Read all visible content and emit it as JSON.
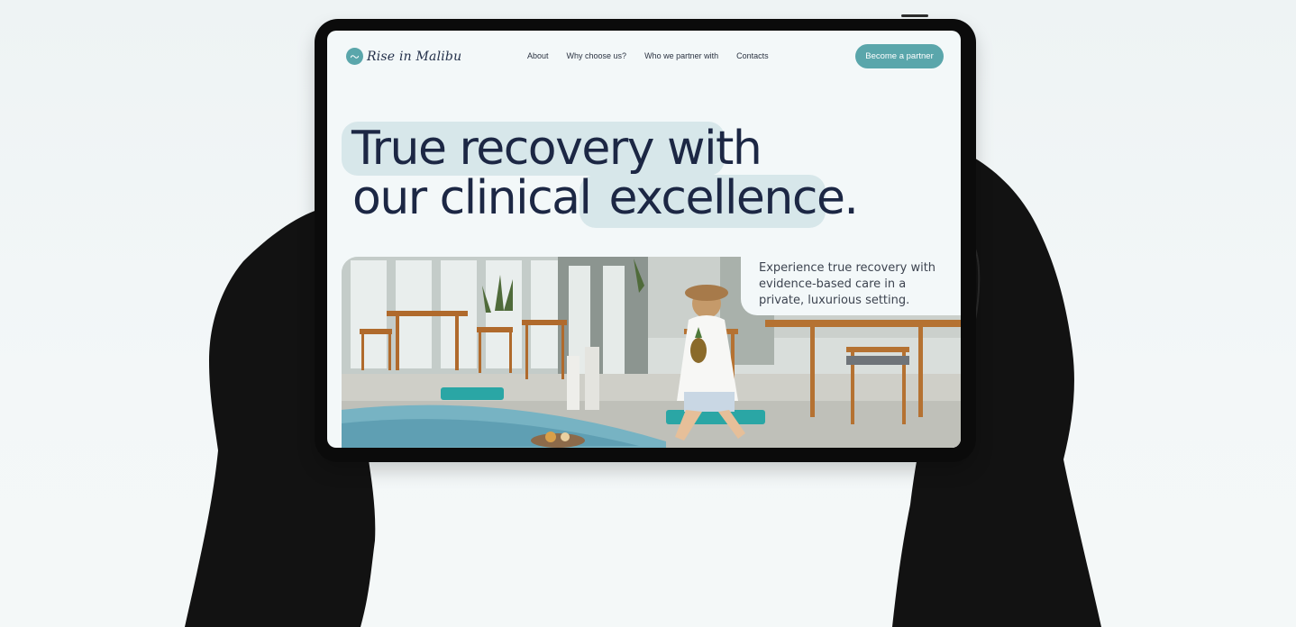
{
  "site": {
    "logo_text": "Rise in Malibu",
    "nav": [
      {
        "label": "About"
      },
      {
        "label": "Why choose us?"
      },
      {
        "label": "Who we partner with"
      },
      {
        "label": "Contacts"
      }
    ],
    "cta_label": "Become a partner"
  },
  "hero": {
    "headline_line1": "True recovery with",
    "headline_line2_part1": "our clinical",
    "headline_line2_part2": "excellence.",
    "caption": "Experience true recovery with evidence-based care in a private, luxurious setting."
  },
  "colors": {
    "accent": "#5aa6ab",
    "highlight": "#d7e7ea",
    "text_dark": "#1c2744",
    "background": "#f3f8f9"
  }
}
